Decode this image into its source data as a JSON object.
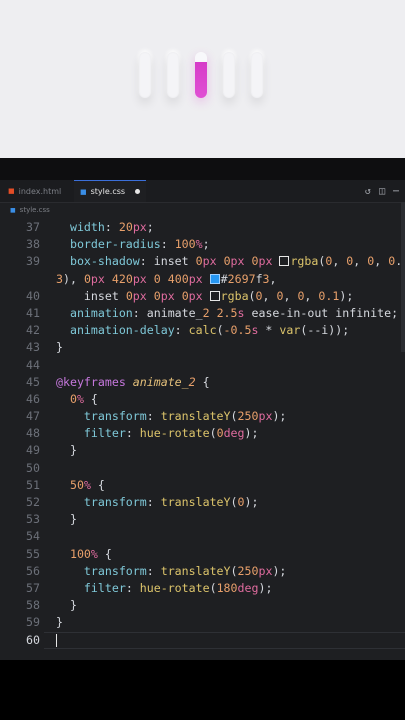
{
  "preview": {
    "pill_count": 5,
    "active_index": 2,
    "active_color": "#d63cc8"
  },
  "tabs": [
    {
      "label": "index.html",
      "icon": "html5-icon",
      "active": false
    },
    {
      "label": "style.css",
      "icon": "css3-icon",
      "active": true,
      "unsaved": true
    }
  ],
  "breadcrumb": {
    "file": "style.css"
  },
  "colors": {
    "accent_blue": "#2697f3",
    "editor_bg": "#1e1f22"
  },
  "code_lines": [
    {
      "num": "37",
      "text": "  width: 20px;"
    },
    {
      "num": "38",
      "text": "  border-radius: 100%;"
    },
    {
      "num": "39",
      "text": "  box-shadow: inset 0px 0px 0px □rgba(0, 0, 0, 0."
    },
    {
      "num": "",
      "text": "3), 0px 420px 0 400px ■#2697f3,"
    },
    {
      "num": "40",
      "text": "    inset 0px 0px 0px □rgba(0, 0, 0, 0.1);"
    },
    {
      "num": "41",
      "text": "  animation: animate_2 2.5s ease-in-out infinite;"
    },
    {
      "num": "42",
      "text": "  animation-delay: calc(-0.5s * var(--i));"
    },
    {
      "num": "43",
      "text": "}"
    },
    {
      "num": "44",
      "text": ""
    },
    {
      "num": "45",
      "text": "@keyframes animate_2 {"
    },
    {
      "num": "46",
      "text": "  0% {"
    },
    {
      "num": "47",
      "text": "    transform: translateY(250px);"
    },
    {
      "num": "48",
      "text": "    filter: hue-rotate(0deg);"
    },
    {
      "num": "49",
      "text": "  }"
    },
    {
      "num": "50",
      "text": ""
    },
    {
      "num": "51",
      "text": "  50% {"
    },
    {
      "num": "52",
      "text": "    transform: translateY(0);"
    },
    {
      "num": "53",
      "text": "  }"
    },
    {
      "num": "54",
      "text": ""
    },
    {
      "num": "55",
      "text": "  100% {"
    },
    {
      "num": "56",
      "text": "    transform: translateY(250px);"
    },
    {
      "num": "57",
      "text": "    filter: hue-rotate(180deg);"
    },
    {
      "num": "58",
      "text": "  }"
    },
    {
      "num": "59",
      "text": "}"
    },
    {
      "num": "60",
      "text": ""
    }
  ]
}
